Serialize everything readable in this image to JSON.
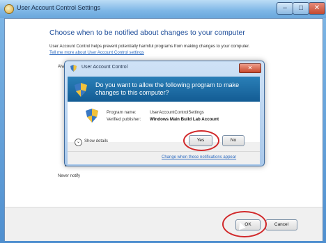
{
  "window": {
    "title": "User Account Control Settings",
    "min_glyph": "–",
    "max_glyph": "□",
    "close_glyph": "✕"
  },
  "main": {
    "heading": "Choose when to be notified about changes to your computer",
    "description": "User Account Control helps prevent potentially harmful programs from making changes to your computer.",
    "link": "Tell me more about User Account Control settings",
    "slider_top_label": "Alw",
    "slider_bottom_label": "Never notify"
  },
  "buttons": {
    "ok": "OK",
    "cancel": "Cancel"
  },
  "uac_dialog": {
    "title": "User Account Control",
    "close_glyph": "✕",
    "question": "Do you want to allow the following program to make changes to this computer?",
    "program_name_label": "Program name:",
    "program_name_value": "UserAccountControlSettings",
    "publisher_label": "Verified publisher:",
    "publisher_value": "Windows Main Build Lab Account",
    "show_details": "Show details",
    "show_details_glyph": "⌄",
    "yes": "Yes",
    "no": "No",
    "change_link": "Change when these notifications appear"
  },
  "colors": {
    "heading": "#1f4e9a",
    "link": "#2d6bc0",
    "highlight": "#d1282a",
    "banner": "#135c94"
  },
  "icons": [
    "uac-shield-icon",
    "program-shield-icon",
    "title-icon",
    "mouse-cursor-icon",
    "show-details-icon"
  ]
}
